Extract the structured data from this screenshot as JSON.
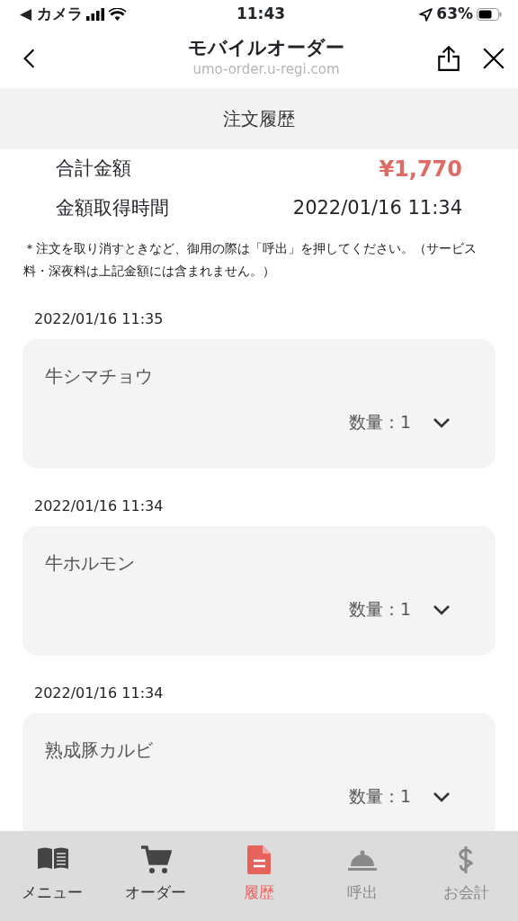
{
  "status_bar": {
    "back_label": "◀ カメラ",
    "time": "11:43",
    "battery": "63%"
  },
  "browser": {
    "title": "モバイルオーダー",
    "url": "umo-order.u-regi.com"
  },
  "page_title": "注文履歴",
  "summary": [
    {
      "label": "合計金額",
      "value": "¥1,770",
      "kind": "price"
    },
    {
      "label": "金額取得時間",
      "value": "2022/01/16 11:34",
      "kind": "time"
    }
  ],
  "note": "＊注文を取り消すときなど、御用の際は「呼出」を押してください。（サービス料・深夜料は上記金額には含まれません。）",
  "orders": [
    {
      "time": "2022/01/16 11:35",
      "item": "牛シマチョウ",
      "quantity": "数量：1"
    },
    {
      "time": "2022/01/16 11:34",
      "item": "牛ホルモン",
      "quantity": "数量：1"
    },
    {
      "time": "2022/01/16 11:34",
      "item": "熟成豚カルビ",
      "quantity": "数量：1"
    }
  ],
  "tabs": [
    {
      "label": "メニュー",
      "kind": "book",
      "selected": false,
      "disabled": false
    },
    {
      "label": "オーダー",
      "kind": "cart",
      "selected": false,
      "disabled": false
    },
    {
      "label": "履歴",
      "kind": "file",
      "selected": true,
      "disabled": false
    },
    {
      "label": "呼出",
      "kind": "bell",
      "selected": false,
      "disabled": true
    },
    {
      "label": "お会計",
      "kind": "dollar",
      "selected": false,
      "disabled": true
    }
  ]
}
